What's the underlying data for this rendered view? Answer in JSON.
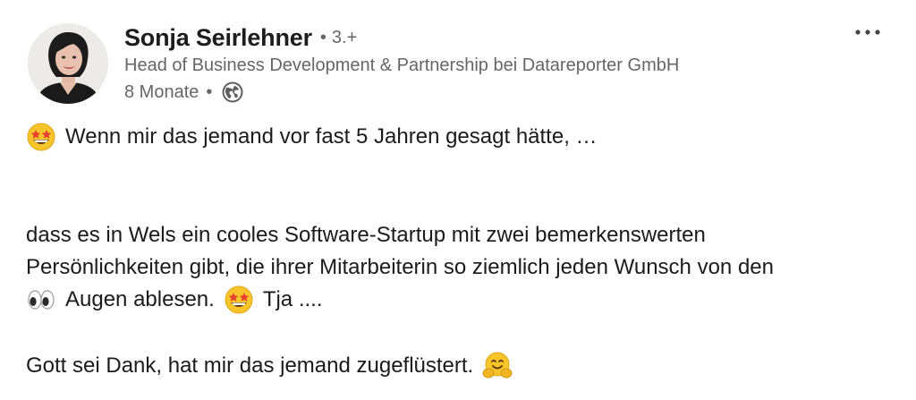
{
  "author": {
    "name": "Sonja Seirlehner",
    "separator": "•",
    "degree": "3.+",
    "headline": "Head of Business Development & Partnership bei Datareporter GmbH",
    "time": "8 Monate",
    "meta_separator": "•",
    "visibility_icon": "globe-icon",
    "avatar_icon": "profile-photo"
  },
  "menu": {
    "more_icon": "more-horizontal-icon"
  },
  "post": {
    "line1": {
      "emoji": "star-struck-emoji",
      "text": "Wenn mir das jemand vor fast 5 Jahren gesagt hätte, …"
    },
    "line2": "dass es in Wels ein cooles Software-Startup mit zwei bemerkenswerten",
    "line3": "Persönlichkeiten gibt, die ihrer Mitarbeiterin so ziemlich jeden Wunsch von den",
    "line4": {
      "emoji1": "eyes-emoji",
      "text1": "Augen ablesen.",
      "emoji2": "star-struck-emoji",
      "text2": "Tja ...."
    },
    "line5": {
      "text": "Gott sei Dank, hat mir das jemand zugeflüstert.",
      "emoji": "hugging-face-emoji"
    }
  },
  "colors": {
    "name": "#1d1d1d",
    "secondary_text": "#666666",
    "body_text": "#1b1b1b",
    "background": "#ffffff"
  }
}
